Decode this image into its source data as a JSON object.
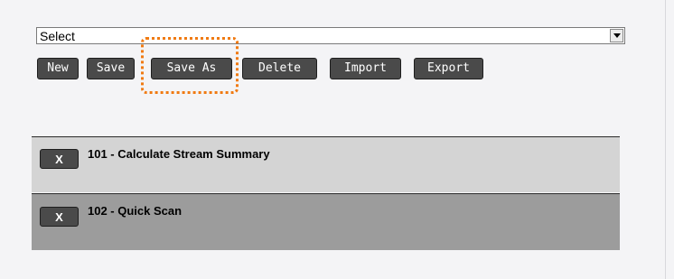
{
  "select": {
    "value": "Select"
  },
  "toolbar": {
    "new_label": "New",
    "save_label": "Save",
    "save_as_label": "Save As",
    "delete_label": "Delete",
    "import_label": "Import",
    "export_label": "Export"
  },
  "highlight": {
    "color": "#f07a12",
    "target": "save-as-button"
  },
  "items": [
    {
      "remove_label": "X",
      "label": "101 - Calculate Stream Summary"
    },
    {
      "remove_label": "X",
      "label": "102 - Quick Scan"
    }
  ]
}
